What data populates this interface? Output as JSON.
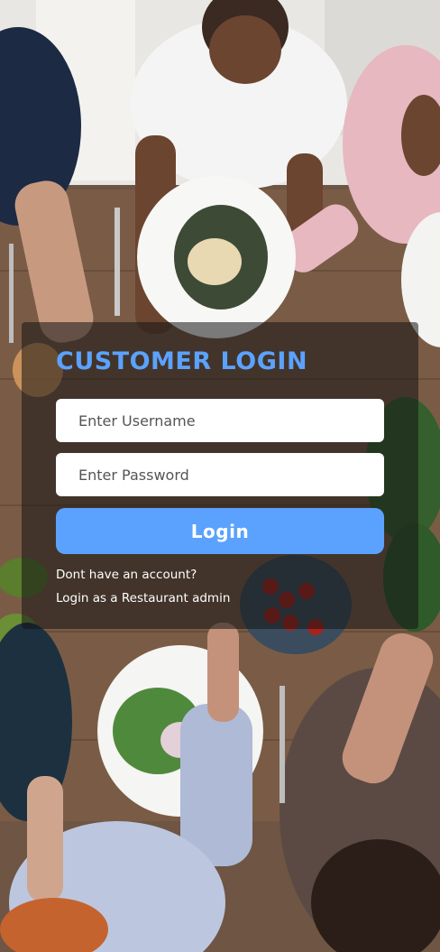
{
  "login": {
    "title": "CUSTOMER LOGIN",
    "username_placeholder": "Enter Username",
    "password_placeholder": "Enter Password",
    "button_label": "Login",
    "signup_link": "Dont have an account?",
    "admin_link": "Login as a Restaurant admin"
  },
  "colors": {
    "accent": "#5ba2ff",
    "card_overlay": "rgba(20,20,20,0.55)",
    "text_light": "#ffffff"
  }
}
